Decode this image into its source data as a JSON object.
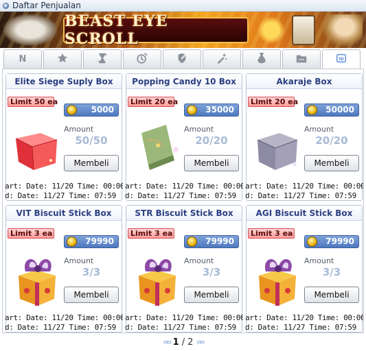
{
  "window": {
    "title": "Daftar Penjualan"
  },
  "banner": {
    "logo_text": "BEAST EYE SCROLL"
  },
  "tabs": [
    {
      "label": "N",
      "icon": "new-icon"
    },
    {
      "label": "",
      "icon": "star-icon"
    },
    {
      "label": "",
      "icon": "hourglass-icon"
    },
    {
      "label": "",
      "icon": "clock-icon"
    },
    {
      "label": "",
      "icon": "shield-sword-icon"
    },
    {
      "label": "",
      "icon": "wand-sparkle-icon"
    },
    {
      "label": "",
      "icon": "potion-icon"
    },
    {
      "label": "",
      "icon": "folder-icon"
    },
    {
      "label": "",
      "icon": "id-card-icon"
    }
  ],
  "active_tab_index": 8,
  "items": [
    {
      "name": "Elite Siege Suply Box",
      "limit": "Limit 50 ea",
      "price": "5000",
      "amount_label": "Amount",
      "amount": "50/50",
      "buy_label": "Membeli",
      "start": "art: Date: 11/20 Time: 00:00",
      "end": "d: Date: 11/27 Time: 07:59",
      "art": "red-box"
    },
    {
      "name": "Popping Candy 10 Box",
      "limit": "Limit 20 ea",
      "price": "35000",
      "amount_label": "Amount",
      "amount": "20/20",
      "buy_label": "Membeli",
      "start": "art: Date: 11/20 Time: 00:00",
      "end": "d: Date: 11/27 Time: 07:59",
      "art": "green-box"
    },
    {
      "name": "Akaraje Box",
      "limit": "Limit 20 ea",
      "price": "50000",
      "amount_label": "Amount",
      "amount": "20/20",
      "buy_label": "Membeli",
      "start": "art: Date: 11/20 Time: 00:00",
      "end": "d: Date: 11/27 Time: 07:59",
      "art": "gray-box"
    },
    {
      "name": "VIT Biscuit Stick Box",
      "limit": "Limit 3 ea",
      "price": "79990",
      "amount_label": "Amount",
      "amount": "3/3",
      "buy_label": "Membeli",
      "start": "art: Date: 11/20 Time: 00:00",
      "end": "d: Date: 11/27 Time: 07:59",
      "art": "gift-box"
    },
    {
      "name": "STR Biscuit Stick Box",
      "limit": "Limit 3 ea",
      "price": "79990",
      "amount_label": "Amount",
      "amount": "3/3",
      "buy_label": "Membeli",
      "start": "art: Date: 11/20 Time: 00:00",
      "end": "d: Date: 11/27 Time: 07:59",
      "art": "gift-box"
    },
    {
      "name": "AGI Biscuit Stick Box",
      "limit": "Limit 3 ea",
      "price": "79990",
      "amount_label": "Amount",
      "amount": "3/3",
      "buy_label": "Membeli",
      "start": "art: Date: 11/20 Time: 00:00",
      "end": "d: Date: 11/27 Time: 07:59",
      "art": "gift-box"
    }
  ],
  "pager": {
    "current": "1",
    "separator": "/",
    "total": "2",
    "prev": "««",
    "next": "»»"
  },
  "colors": {
    "accent": "#5a8fd6",
    "title_text": "#2c3f82",
    "price_bg": "#4e78bf",
    "limit_bg": "#ff9d9d"
  }
}
